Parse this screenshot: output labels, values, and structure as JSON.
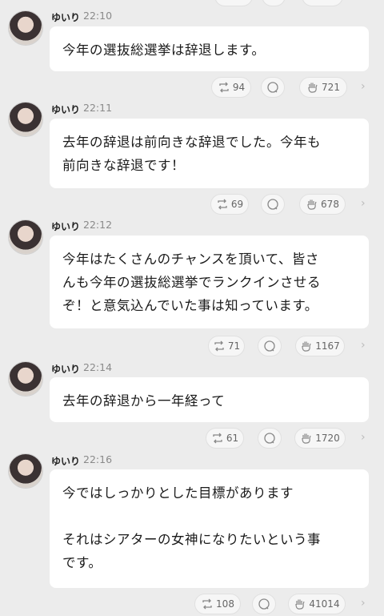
{
  "messages": [
    {
      "user": "ゆいり",
      "time": "22:10",
      "text": "今年の選抜総選挙は辞退します。",
      "retweets": "94",
      "likes": "721"
    },
    {
      "user": "ゆいり",
      "time": "22:11",
      "text": "去年の辞退は前向きな辞退でした。今年も\n前向きな辞退です！",
      "retweets": "69",
      "likes": "678"
    },
    {
      "user": "ゆいり",
      "time": "22:12",
      "text": "今年はたくさんのチャンスを頂いて、皆さ\nんも今年の選抜総選挙でランクインさせる\nぞ！と意気込んでいた事は知っています。",
      "retweets": "71",
      "likes": "1167"
    },
    {
      "user": "ゆいり",
      "time": "22:14",
      "text": "去年の辞退から一年経って",
      "retweets": "61",
      "likes": "1720"
    },
    {
      "user": "ゆいり",
      "time": "22:16",
      "text": "今ではしっかりとした目標があります\n\nそれはシアターの女神になりたいという事\nです。",
      "retweets": "108",
      "likes": "41014"
    }
  ],
  "icons": {
    "retweet": "retweet-icon",
    "comment": "comment-icon",
    "like": "clap-icon",
    "more": "chevron-right-icon"
  }
}
